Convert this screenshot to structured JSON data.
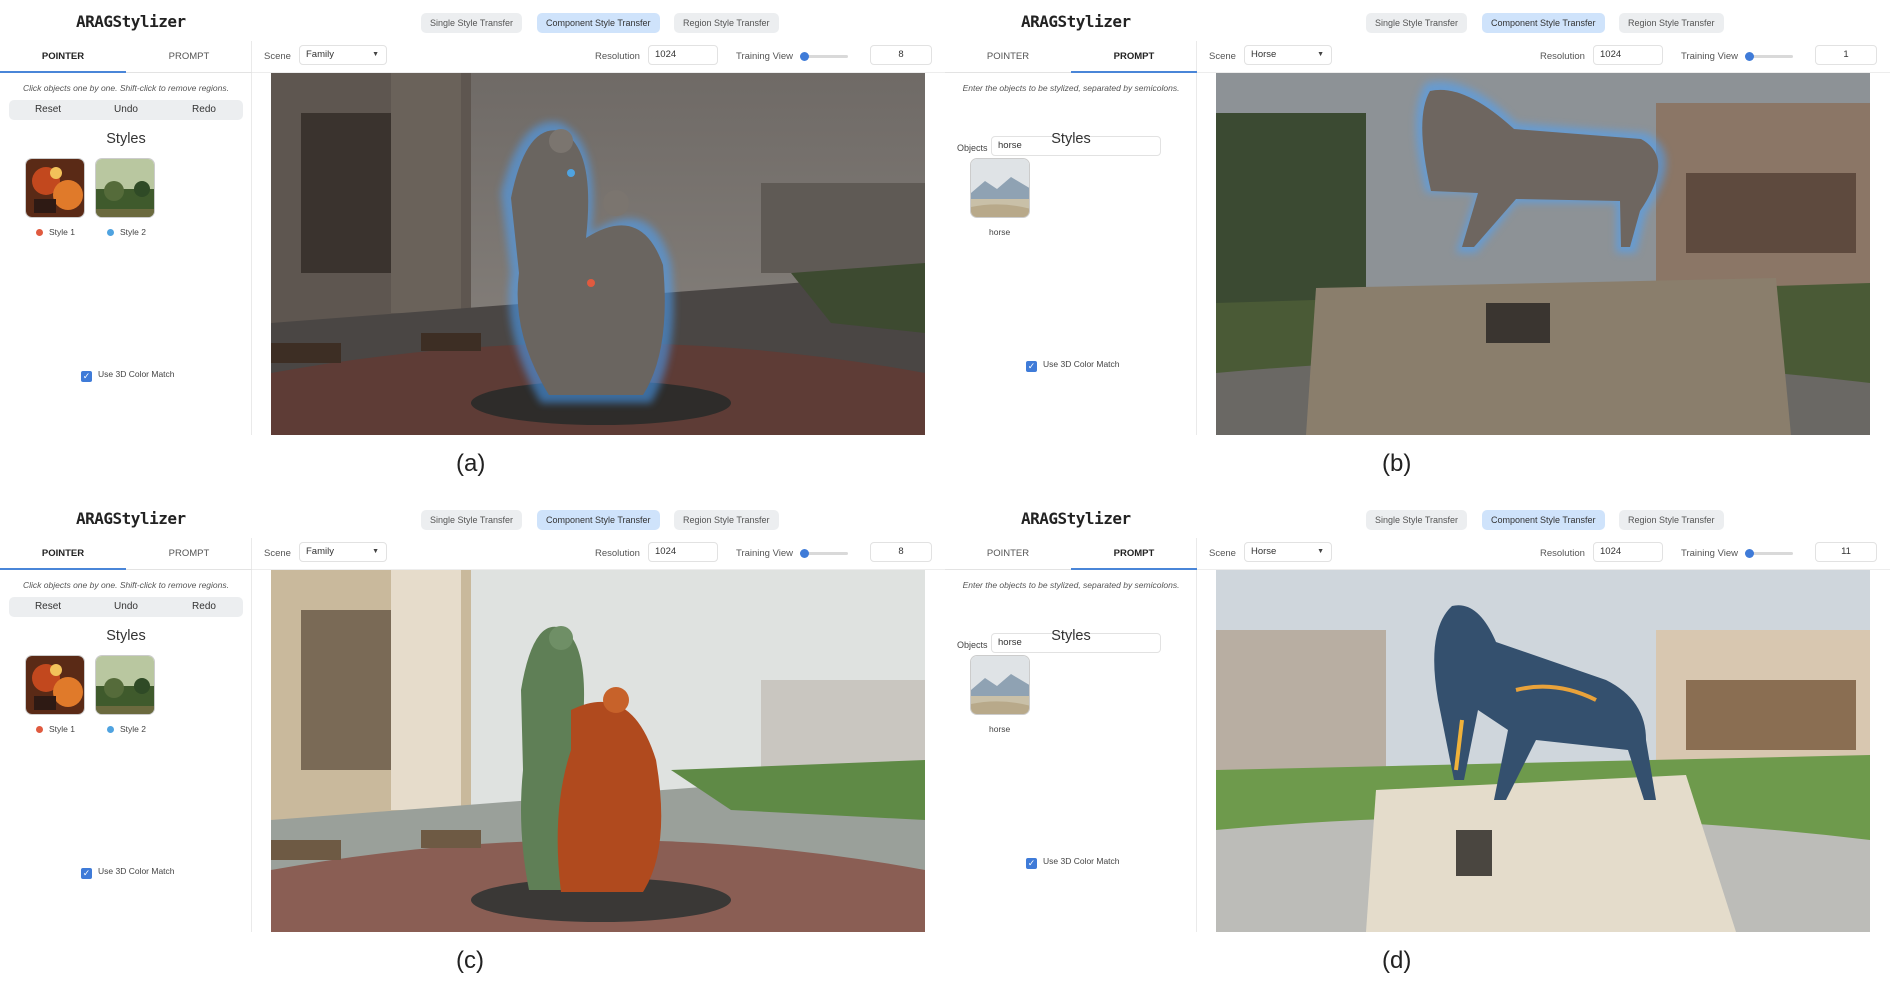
{
  "logo_text": "ARAGStylizer",
  "mode_buttons": [
    "Single Style Transfer",
    "Component Style Transfer",
    "Region Style Transfer"
  ],
  "tab_labels": [
    "POINTER",
    "PROMPT"
  ],
  "pointer_hint": "Click objects one by one. Shift-click to remove regions.",
  "prompt_hint": "Enter the objects to be stylized, separated by semicolons.",
  "actions": [
    "Reset",
    "Undo",
    "Redo"
  ],
  "styles_title": "Styles",
  "objects_label": "Objects",
  "color_match_label": "Use 3D Color Match",
  "scene_label": "Scene",
  "resolution_label": "Resolution",
  "training_view_label": "Training View",
  "colors": {
    "accent": "#3f7bd8",
    "active_mode": "#cfe3fb",
    "style1_dot": "#e05a3f",
    "style2_dot": "#4fa3e0"
  },
  "panels": [
    {
      "caption": "(a)",
      "active_tab": "POINTER",
      "scene": "Family",
      "resolution": "1024",
      "training_view": "8",
      "training_view_slider": 0.05,
      "styles": [
        {
          "label": "Style 1",
          "dot": "#e05a3f"
        },
        {
          "label": "Style 2",
          "dot": "#4fa3e0"
        }
      ]
    },
    {
      "caption": "(b)",
      "active_tab": "PROMPT",
      "scene": "Horse",
      "resolution": "1024",
      "training_view": "1",
      "training_view_slider": 0.05,
      "objects_value": "horse",
      "styles": [
        {
          "label": "horse"
        }
      ]
    },
    {
      "caption": "(c)",
      "active_tab": "POINTER",
      "scene": "Family",
      "resolution": "1024",
      "training_view": "8",
      "training_view_slider": 0.05,
      "styles": [
        {
          "label": "Style 1",
          "dot": "#e05a3f"
        },
        {
          "label": "Style 2",
          "dot": "#4fa3e0"
        }
      ]
    },
    {
      "caption": "(d)",
      "active_tab": "PROMPT",
      "scene": "Horse",
      "resolution": "1024",
      "training_view": "11",
      "training_view_slider": 0.05,
      "objects_value": "horse",
      "styles": [
        {
          "label": "horse"
        }
      ]
    }
  ]
}
